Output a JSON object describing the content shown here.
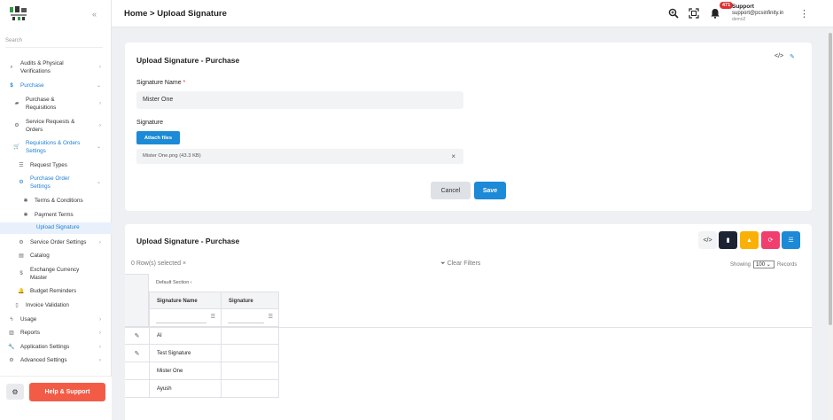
{
  "sidebar": {
    "search_placeholder": "Search",
    "items": [
      {
        "label": "Audits & Physical Verifications",
        "icon": "audit-icon"
      },
      {
        "label": "Purchase",
        "icon": "dollar-icon"
      },
      {
        "label": "Purchase & Requisitions",
        "icon": "truck-icon"
      },
      {
        "label": "Service Requests & Orders",
        "icon": "gears-icon"
      },
      {
        "label": "Requisitions & Orders Settings",
        "icon": "cart-icon"
      },
      {
        "label": "Request Types",
        "icon": "list-icon"
      },
      {
        "label": "Purchase Order Settings",
        "icon": "gear-icon"
      },
      {
        "label": "Terms & Conditions",
        "icon": "asterisk-icon"
      },
      {
        "label": "Payment Terms",
        "icon": "asterisk-icon"
      },
      {
        "label": "Upload Signature",
        "icon": ""
      },
      {
        "label": "Service Order Settings",
        "icon": "gear-icon"
      },
      {
        "label": "Catalog",
        "icon": "book-icon"
      },
      {
        "label": "Exchange Currency Master",
        "icon": "dollar-icon"
      },
      {
        "label": "Budget Reminders",
        "icon": "bell-icon"
      },
      {
        "label": "Invoice Validation",
        "icon": "file-icon"
      },
      {
        "label": "Usage",
        "icon": "bolt-icon"
      },
      {
        "label": "Reports",
        "icon": "report-icon"
      },
      {
        "label": "Application Settings",
        "icon": "wrench-icon"
      },
      {
        "label": "Advanced Settings",
        "icon": "gears-icon"
      }
    ],
    "help_label": "Help & Support"
  },
  "header": {
    "breadcrumb": "Home > Upload Signature",
    "notification_count": "471",
    "user_name": "Support",
    "user_email": "support@pcsinfinity.in",
    "user_org": "demo2"
  },
  "form": {
    "title": "Upload Signature - Purchase",
    "signature_name_label": "Signature Name",
    "required_mark": "*",
    "signature_name_value": "Mister One",
    "signature_label": "Signature",
    "attach_label": "Attach files",
    "file_name": "Mister One.png (43.3 KB)",
    "cancel_label": "Cancel",
    "save_label": "Save"
  },
  "grid": {
    "title": "Upload Signature - Purchase",
    "rows_selected": "0 Row(s) selected",
    "clear_filters": "Clear Filters",
    "showing_label": "Showing",
    "page_size": "100",
    "records_label": "Records",
    "section_header": "Default Section",
    "columns": [
      "Signature Name",
      "Signature"
    ],
    "rows": [
      "AI",
      "Test Signature",
      "Mister One",
      "Ayush"
    ]
  },
  "colors": {
    "accent": "#1c8ad6",
    "help": "#f25c47",
    "badge": "#e03131"
  }
}
